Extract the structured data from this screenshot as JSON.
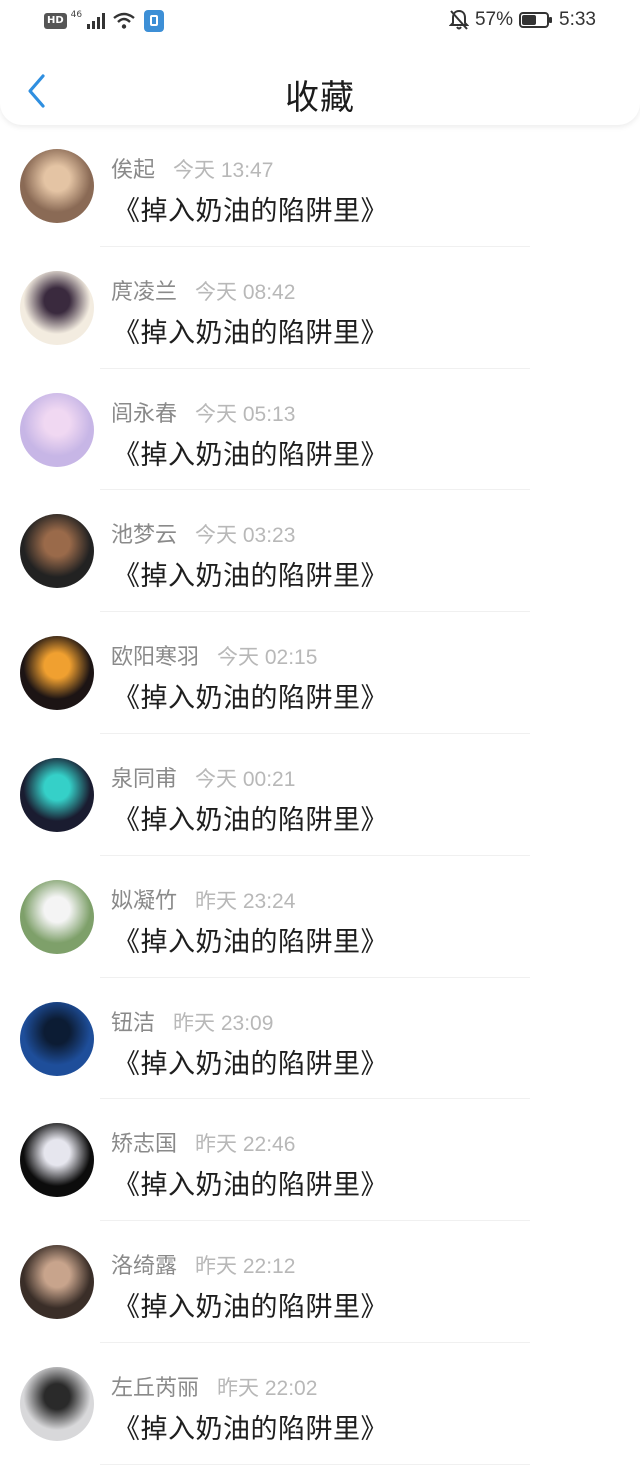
{
  "status_bar": {
    "hd": "HD",
    "network": "46",
    "battery_text": "57%",
    "battery_level": 0.57,
    "time": "5:33"
  },
  "header": {
    "title": "收藏"
  },
  "favorites": [
    {
      "name": "俟起",
      "time": "今天 13:47",
      "title": "《掉入奶油的陷阱里》",
      "avatar": {
        "bg": "#8a6a55",
        "accent": "#e4c4a4"
      }
    },
    {
      "name": "庹凌兰",
      "time": "今天 08:42",
      "title": "《掉入奶油的陷阱里》",
      "avatar": {
        "bg": "#f3ece0",
        "accent": "#3a2a3e"
      }
    },
    {
      "name": "闾永春",
      "time": "今天 05:13",
      "title": "《掉入奶油的陷阱里》",
      "avatar": {
        "bg": "#c7b6e6",
        "accent": "#f0d8f2"
      }
    },
    {
      "name": "池梦云",
      "time": "今天 03:23",
      "title": "《掉入奶油的陷阱里》",
      "avatar": {
        "bg": "#222222",
        "accent": "#9a6a4a"
      }
    },
    {
      "name": "欧阳寒羽",
      "time": "今天 02:15",
      "title": "《掉入奶油的陷阱里》",
      "avatar": {
        "bg": "#1c1414",
        "accent": "#f0a030"
      }
    },
    {
      "name": "泉同甫",
      "time": "今天 00:21",
      "title": "《掉入奶油的陷阱里》",
      "avatar": {
        "bg": "#1a1c30",
        "accent": "#35d0c8"
      }
    },
    {
      "name": "姒凝竹",
      "time": "昨天 23:24",
      "title": "《掉入奶油的陷阱里》",
      "avatar": {
        "bg": "#7ea06a",
        "accent": "#f4f4f4"
      }
    },
    {
      "name": "钮洁",
      "time": "昨天 23:09",
      "title": "《掉入奶油的陷阱里》",
      "avatar": {
        "bg": "#1e4e9a",
        "accent": "#0c1c34"
      }
    },
    {
      "name": "矫志国",
      "time": "昨天 22:46",
      "title": "《掉入奶油的陷阱里》",
      "avatar": {
        "bg": "#0c0c0c",
        "accent": "#e6e6ee"
      }
    },
    {
      "name": "洛绮露",
      "time": "昨天 22:12",
      "title": "《掉入奶油的陷阱里》",
      "avatar": {
        "bg": "#3a2e28",
        "accent": "#c8a48c"
      }
    },
    {
      "name": "左丘芮丽",
      "time": "昨天 22:02",
      "title": "《掉入奶油的陷阱里》",
      "avatar": {
        "bg": "#d8d8da",
        "accent": "#2a2a2a"
      }
    }
  ],
  "colors": {
    "accent": "#2f8fe0",
    "name": "#8a8a8a",
    "time": "#b8b8b8",
    "title": "#1e1e1e"
  }
}
